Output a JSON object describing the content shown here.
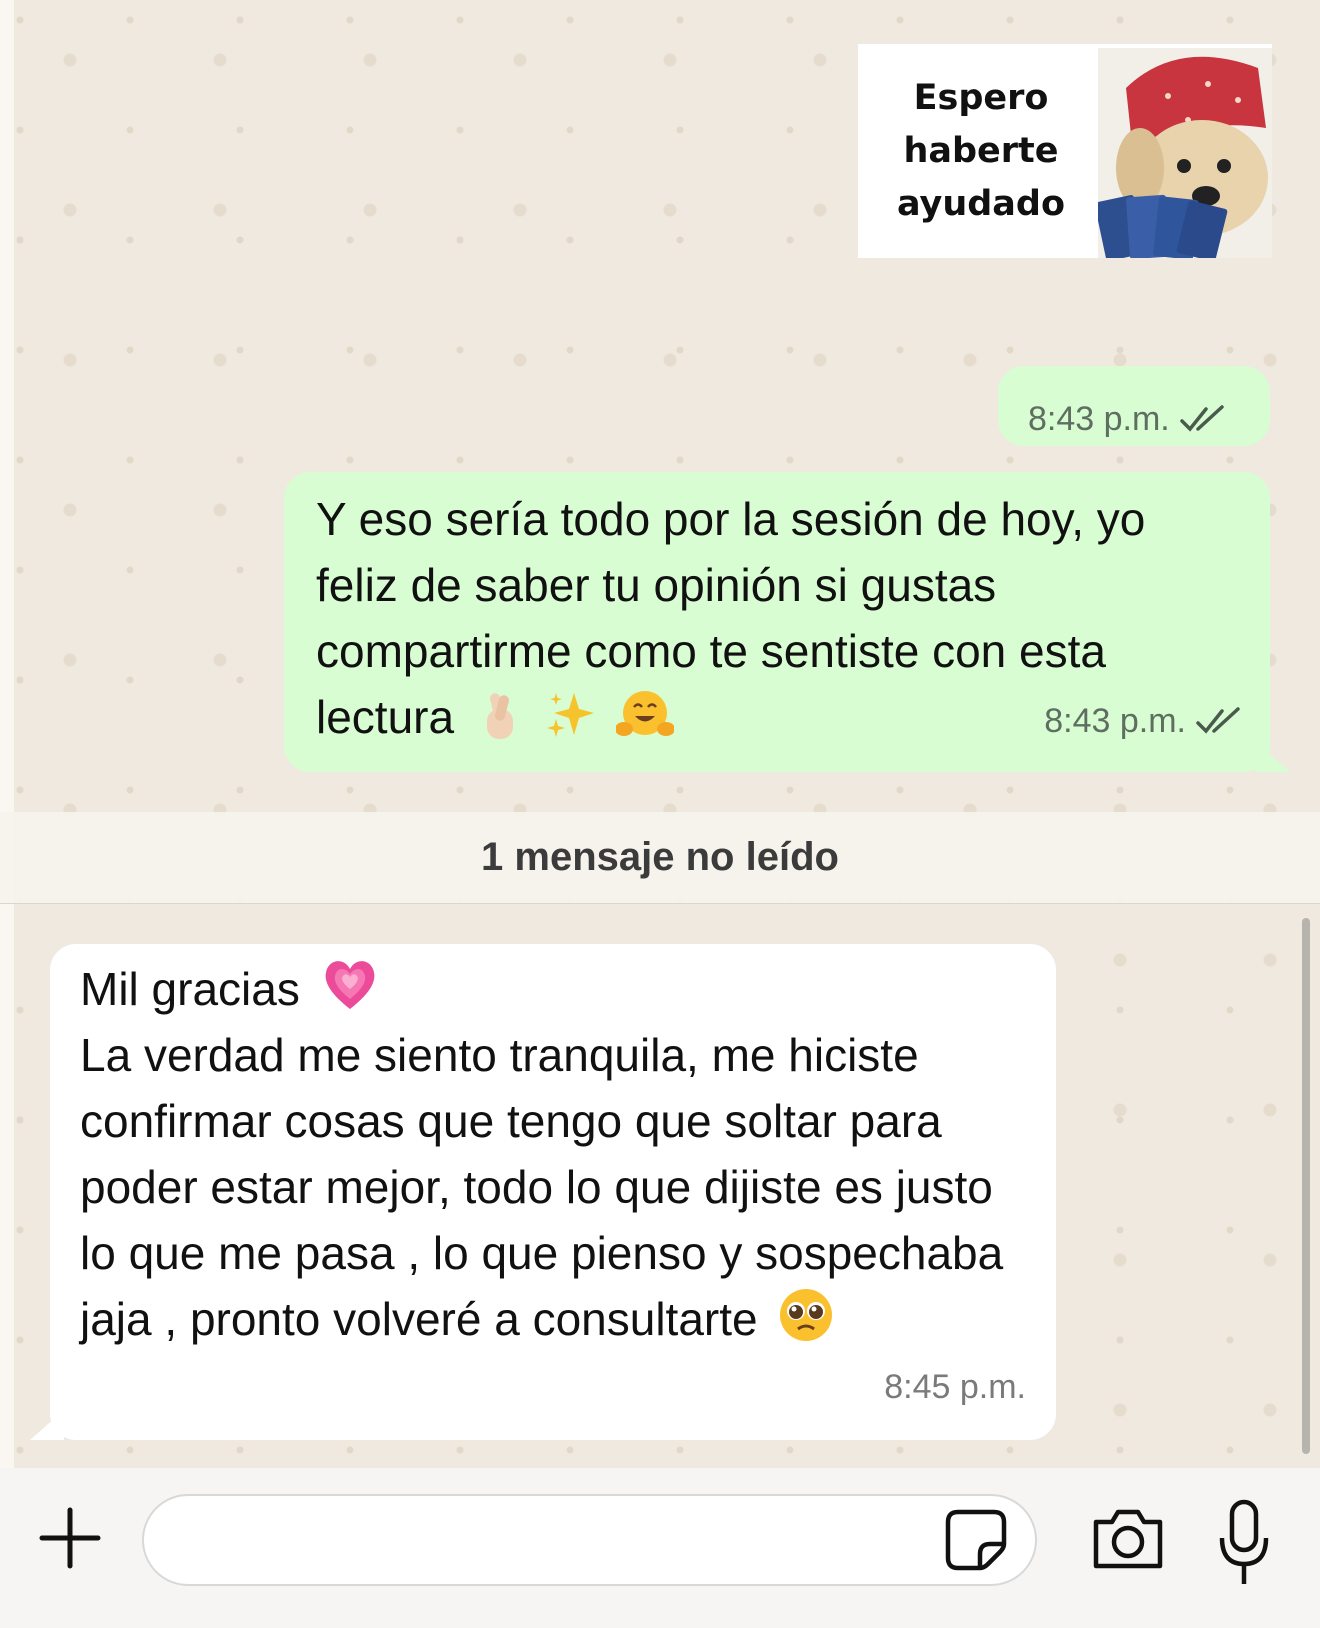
{
  "sticker": {
    "lines": [
      "Espero",
      "haberte",
      "ayudado"
    ]
  },
  "messages": [
    {
      "direction": "outgoing",
      "kind": "sticker-timestamp",
      "time": "8:43 p.m.",
      "status_icon": "double-check-icon"
    },
    {
      "direction": "outgoing",
      "text": "Y eso sería todo por la sesión de hoy, yo feliz de saber tu opinión si gustas compartirme como te sentiste con esta lectura",
      "emojis": [
        "crossed-fingers-emoji",
        "sparkles-emoji",
        "hugging-face-emoji"
      ],
      "time": "8:43 p.m.",
      "status_icon": "double-check-icon"
    },
    {
      "direction": "incoming",
      "line1": "Mil gracias",
      "line1_emoji": "growing-heart-emoji",
      "body": "La verdad me siento tranquila, me hiciste confirmar cosas que tengo que soltar para poder estar mejor, todo lo que dijiste es justo lo que me pasa , lo que pienso y sospechaba jaja , pronto volveré a consultarte",
      "end_emoji": "pleading-face-emoji",
      "time": "8:45 p.m."
    }
  ],
  "unread_banner": "1 mensaje no leído",
  "composer": {
    "input_value": "",
    "icons": [
      "plus-icon",
      "sticker-icon",
      "camera-icon",
      "microphone-icon"
    ]
  },
  "colors": {
    "outgoing_bubble": "#d9fdd3",
    "incoming_bubble": "#ffffff",
    "chat_background": "#efe9df"
  }
}
